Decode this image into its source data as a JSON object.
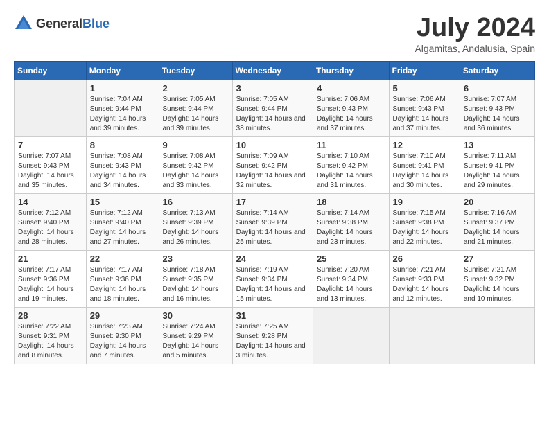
{
  "header": {
    "logo_general": "General",
    "logo_blue": "Blue",
    "month_title": "July 2024",
    "subtitle": "Algamitas, Andalusia, Spain"
  },
  "calendar": {
    "weekdays": [
      "Sunday",
      "Monday",
      "Tuesday",
      "Wednesday",
      "Thursday",
      "Friday",
      "Saturday"
    ],
    "weeks": [
      [
        {
          "day": "",
          "sunrise": "",
          "sunset": "",
          "daylight": "",
          "empty": true
        },
        {
          "day": "1",
          "sunrise": "Sunrise: 7:04 AM",
          "sunset": "Sunset: 9:44 PM",
          "daylight": "Daylight: 14 hours and 39 minutes.",
          "empty": false
        },
        {
          "day": "2",
          "sunrise": "Sunrise: 7:05 AM",
          "sunset": "Sunset: 9:44 PM",
          "daylight": "Daylight: 14 hours and 39 minutes.",
          "empty": false
        },
        {
          "day": "3",
          "sunrise": "Sunrise: 7:05 AM",
          "sunset": "Sunset: 9:44 PM",
          "daylight": "Daylight: 14 hours and 38 minutes.",
          "empty": false
        },
        {
          "day": "4",
          "sunrise": "Sunrise: 7:06 AM",
          "sunset": "Sunset: 9:43 PM",
          "daylight": "Daylight: 14 hours and 37 minutes.",
          "empty": false
        },
        {
          "day": "5",
          "sunrise": "Sunrise: 7:06 AM",
          "sunset": "Sunset: 9:43 PM",
          "daylight": "Daylight: 14 hours and 37 minutes.",
          "empty": false
        },
        {
          "day": "6",
          "sunrise": "Sunrise: 7:07 AM",
          "sunset": "Sunset: 9:43 PM",
          "daylight": "Daylight: 14 hours and 36 minutes.",
          "empty": false
        }
      ],
      [
        {
          "day": "7",
          "sunrise": "Sunrise: 7:07 AM",
          "sunset": "Sunset: 9:43 PM",
          "daylight": "Daylight: 14 hours and 35 minutes.",
          "empty": false
        },
        {
          "day": "8",
          "sunrise": "Sunrise: 7:08 AM",
          "sunset": "Sunset: 9:43 PM",
          "daylight": "Daylight: 14 hours and 34 minutes.",
          "empty": false
        },
        {
          "day": "9",
          "sunrise": "Sunrise: 7:08 AM",
          "sunset": "Sunset: 9:42 PM",
          "daylight": "Daylight: 14 hours and 33 minutes.",
          "empty": false
        },
        {
          "day": "10",
          "sunrise": "Sunrise: 7:09 AM",
          "sunset": "Sunset: 9:42 PM",
          "daylight": "Daylight: 14 hours and 32 minutes.",
          "empty": false
        },
        {
          "day": "11",
          "sunrise": "Sunrise: 7:10 AM",
          "sunset": "Sunset: 9:42 PM",
          "daylight": "Daylight: 14 hours and 31 minutes.",
          "empty": false
        },
        {
          "day": "12",
          "sunrise": "Sunrise: 7:10 AM",
          "sunset": "Sunset: 9:41 PM",
          "daylight": "Daylight: 14 hours and 30 minutes.",
          "empty": false
        },
        {
          "day": "13",
          "sunrise": "Sunrise: 7:11 AM",
          "sunset": "Sunset: 9:41 PM",
          "daylight": "Daylight: 14 hours and 29 minutes.",
          "empty": false
        }
      ],
      [
        {
          "day": "14",
          "sunrise": "Sunrise: 7:12 AM",
          "sunset": "Sunset: 9:40 PM",
          "daylight": "Daylight: 14 hours and 28 minutes.",
          "empty": false
        },
        {
          "day": "15",
          "sunrise": "Sunrise: 7:12 AM",
          "sunset": "Sunset: 9:40 PM",
          "daylight": "Daylight: 14 hours and 27 minutes.",
          "empty": false
        },
        {
          "day": "16",
          "sunrise": "Sunrise: 7:13 AM",
          "sunset": "Sunset: 9:39 PM",
          "daylight": "Daylight: 14 hours and 26 minutes.",
          "empty": false
        },
        {
          "day": "17",
          "sunrise": "Sunrise: 7:14 AM",
          "sunset": "Sunset: 9:39 PM",
          "daylight": "Daylight: 14 hours and 25 minutes.",
          "empty": false
        },
        {
          "day": "18",
          "sunrise": "Sunrise: 7:14 AM",
          "sunset": "Sunset: 9:38 PM",
          "daylight": "Daylight: 14 hours and 23 minutes.",
          "empty": false
        },
        {
          "day": "19",
          "sunrise": "Sunrise: 7:15 AM",
          "sunset": "Sunset: 9:38 PM",
          "daylight": "Daylight: 14 hours and 22 minutes.",
          "empty": false
        },
        {
          "day": "20",
          "sunrise": "Sunrise: 7:16 AM",
          "sunset": "Sunset: 9:37 PM",
          "daylight": "Daylight: 14 hours and 21 minutes.",
          "empty": false
        }
      ],
      [
        {
          "day": "21",
          "sunrise": "Sunrise: 7:17 AM",
          "sunset": "Sunset: 9:36 PM",
          "daylight": "Daylight: 14 hours and 19 minutes.",
          "empty": false
        },
        {
          "day": "22",
          "sunrise": "Sunrise: 7:17 AM",
          "sunset": "Sunset: 9:36 PM",
          "daylight": "Daylight: 14 hours and 18 minutes.",
          "empty": false
        },
        {
          "day": "23",
          "sunrise": "Sunrise: 7:18 AM",
          "sunset": "Sunset: 9:35 PM",
          "daylight": "Daylight: 14 hours and 16 minutes.",
          "empty": false
        },
        {
          "day": "24",
          "sunrise": "Sunrise: 7:19 AM",
          "sunset": "Sunset: 9:34 PM",
          "daylight": "Daylight: 14 hours and 15 minutes.",
          "empty": false
        },
        {
          "day": "25",
          "sunrise": "Sunrise: 7:20 AM",
          "sunset": "Sunset: 9:34 PM",
          "daylight": "Daylight: 14 hours and 13 minutes.",
          "empty": false
        },
        {
          "day": "26",
          "sunrise": "Sunrise: 7:21 AM",
          "sunset": "Sunset: 9:33 PM",
          "daylight": "Daylight: 14 hours and 12 minutes.",
          "empty": false
        },
        {
          "day": "27",
          "sunrise": "Sunrise: 7:21 AM",
          "sunset": "Sunset: 9:32 PM",
          "daylight": "Daylight: 14 hours and 10 minutes.",
          "empty": false
        }
      ],
      [
        {
          "day": "28",
          "sunrise": "Sunrise: 7:22 AM",
          "sunset": "Sunset: 9:31 PM",
          "daylight": "Daylight: 14 hours and 8 minutes.",
          "empty": false
        },
        {
          "day": "29",
          "sunrise": "Sunrise: 7:23 AM",
          "sunset": "Sunset: 9:30 PM",
          "daylight": "Daylight: 14 hours and 7 minutes.",
          "empty": false
        },
        {
          "day": "30",
          "sunrise": "Sunrise: 7:24 AM",
          "sunset": "Sunset: 9:29 PM",
          "daylight": "Daylight: 14 hours and 5 minutes.",
          "empty": false
        },
        {
          "day": "31",
          "sunrise": "Sunrise: 7:25 AM",
          "sunset": "Sunset: 9:28 PM",
          "daylight": "Daylight: 14 hours and 3 minutes.",
          "empty": false
        },
        {
          "day": "",
          "sunrise": "",
          "sunset": "",
          "daylight": "",
          "empty": true
        },
        {
          "day": "",
          "sunrise": "",
          "sunset": "",
          "daylight": "",
          "empty": true
        },
        {
          "day": "",
          "sunrise": "",
          "sunset": "",
          "daylight": "",
          "empty": true
        }
      ]
    ]
  }
}
